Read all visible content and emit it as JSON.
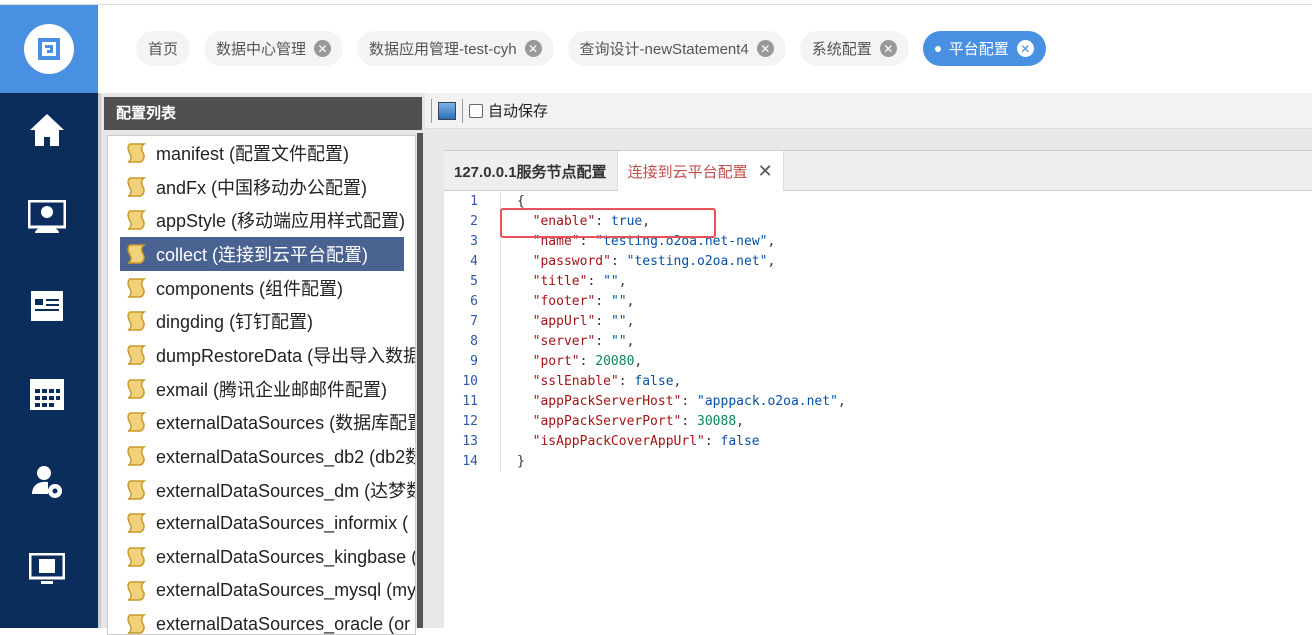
{
  "tabs": [
    {
      "label": "首页",
      "closable": false
    },
    {
      "label": "数据中心管理",
      "closable": true
    },
    {
      "label": "数据应用管理-test-cyh",
      "closable": true
    },
    {
      "label": "查询设计-newStatement4",
      "closable": true
    },
    {
      "label": "系统配置",
      "closable": true
    },
    {
      "label": "平台配置",
      "closable": true,
      "active": true
    }
  ],
  "nav": [
    "home-icon",
    "monitor-user-icon",
    "news-icon",
    "calendar-icon",
    "user-settings-icon",
    "screen-icon"
  ],
  "panel": {
    "title": "配置列表",
    "items": [
      "manifest (配置文件配置)",
      "andFx (中国移动办公配置)",
      "appStyle (移动端应用样式配置)",
      "collect (连接到云平台配置)",
      "components (组件配置)",
      "dingding (钉钉配置)",
      "dumpRestoreData (导出导入数据",
      "exmail (腾讯企业邮邮件配置)",
      "externalDataSources (数据库配置",
      "externalDataSources_db2 (db2数",
      "externalDataSources_dm (达梦数",
      "externalDataSources_informix (",
      "externalDataSources_kingbase (",
      "externalDataSources_mysql (my",
      "externalDataSources_oracle (or"
    ],
    "selected": 3
  },
  "toolbar": {
    "autosave_label": "自动保存",
    "autosave_checked": false
  },
  "editor": {
    "tabs": [
      "127.0.0.1服务节点配置",
      "连接到云平台配置"
    ],
    "active_tab": 1,
    "lines": [
      [
        [
          "p",
          "{"
        ]
      ],
      [
        [
          "p",
          "  "
        ],
        [
          "k",
          "\"enable\""
        ],
        [
          "p",
          ": "
        ],
        [
          "b",
          "true"
        ],
        [
          "p",
          ","
        ]
      ],
      [
        [
          "p",
          "  "
        ],
        [
          "k",
          "\"name\""
        ],
        [
          "p",
          ": "
        ],
        [
          "s",
          "\"testing.o2oa.net-new\""
        ],
        [
          "p",
          ","
        ]
      ],
      [
        [
          "p",
          "  "
        ],
        [
          "k",
          "\"password\""
        ],
        [
          "p",
          ": "
        ],
        [
          "s",
          "\"testing.o2oa.net\""
        ],
        [
          "p",
          ","
        ]
      ],
      [
        [
          "p",
          "  "
        ],
        [
          "k",
          "\"title\""
        ],
        [
          "p",
          ": "
        ],
        [
          "s",
          "\"\""
        ],
        [
          "p",
          ","
        ]
      ],
      [
        [
          "p",
          "  "
        ],
        [
          "k",
          "\"footer\""
        ],
        [
          "p",
          ": "
        ],
        [
          "s",
          "\"\""
        ],
        [
          "p",
          ","
        ]
      ],
      [
        [
          "p",
          "  "
        ],
        [
          "k",
          "\"appUrl\""
        ],
        [
          "p",
          ": "
        ],
        [
          "s",
          "\"\""
        ],
        [
          "p",
          ","
        ]
      ],
      [
        [
          "p",
          "  "
        ],
        [
          "k",
          "\"server\""
        ],
        [
          "p",
          ": "
        ],
        [
          "s",
          "\"\""
        ],
        [
          "p",
          ","
        ]
      ],
      [
        [
          "p",
          "  "
        ],
        [
          "k",
          "\"port\""
        ],
        [
          "p",
          ": "
        ],
        [
          "n",
          "20080"
        ],
        [
          "p",
          ","
        ]
      ],
      [
        [
          "p",
          "  "
        ],
        [
          "k",
          "\"sslEnable\""
        ],
        [
          "p",
          ": "
        ],
        [
          "b",
          "false"
        ],
        [
          "p",
          ","
        ]
      ],
      [
        [
          "p",
          "  "
        ],
        [
          "k",
          "\"appPackServerHost\""
        ],
        [
          "p",
          ": "
        ],
        [
          "s",
          "\"apppack.o2oa.net\""
        ],
        [
          "p",
          ","
        ]
      ],
      [
        [
          "p",
          "  "
        ],
        [
          "k",
          "\"appPackServerPort\""
        ],
        [
          "p",
          ": "
        ],
        [
          "n",
          "30088"
        ],
        [
          "p",
          ","
        ]
      ],
      [
        [
          "p",
          "  "
        ],
        [
          "k",
          "\"isAppPackCoverAppUrl\""
        ],
        [
          "p",
          ": "
        ],
        [
          "b",
          "false"
        ]
      ],
      [
        [
          "p",
          "}"
        ]
      ]
    ]
  }
}
